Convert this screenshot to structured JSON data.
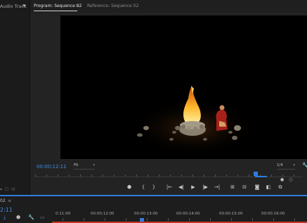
{
  "left_panel": {
    "tab_label": "Audio Track",
    "overflow_chevron": "»",
    "timecode": "2:11"
  },
  "monitor": {
    "tabs": [
      {
        "label": "Program: Sequence 02",
        "active": true
      },
      {
        "label": "Reference: Sequence 02",
        "active": false
      }
    ],
    "tab_menu_glyph": "≡",
    "current_timecode": "00:00:12:11",
    "zoom_select": "Fit",
    "resolution_select": "1/4"
  },
  "transport": {
    "buttons": [
      {
        "name": "add-marker-button",
        "glyph": "⬢"
      },
      {
        "name": "mark-in-button",
        "glyph": "{"
      },
      {
        "name": "mark-out-button",
        "glyph": "}"
      },
      {
        "name": "go-to-in-button",
        "glyph": "|←"
      },
      {
        "name": "step-back-button",
        "glyph": "◀|"
      },
      {
        "name": "play-button",
        "glyph": "▶"
      },
      {
        "name": "step-forward-button",
        "glyph": "|▶"
      },
      {
        "name": "go-to-out-button",
        "glyph": "→|"
      },
      {
        "name": "insert-button",
        "glyph": "⊞"
      },
      {
        "name": "overwrite-button",
        "glyph": "⊟"
      },
      {
        "name": "export-frame-button",
        "glyph": "◙"
      },
      {
        "name": "comparison-view-button",
        "glyph": "◧"
      },
      {
        "name": "multi-camera-button",
        "glyph": "⧉"
      }
    ]
  },
  "timeline": {
    "sequence_title": "02",
    "menu_glyph": "≡",
    "timecode": "2:11",
    "ruler_labels": [
      "0:11:00",
      "00:00:12:00",
      "00:00:13:00",
      "00:00:14:00",
      "00:00:15:00",
      "00:00:16:00"
    ]
  },
  "colors": {
    "accent_blue": "#2f7be0",
    "timecode_blue": "#3d8ee8",
    "panel_bg": "#232323",
    "viewer_bg": "#000000",
    "work_area_red": "#c0392b"
  }
}
